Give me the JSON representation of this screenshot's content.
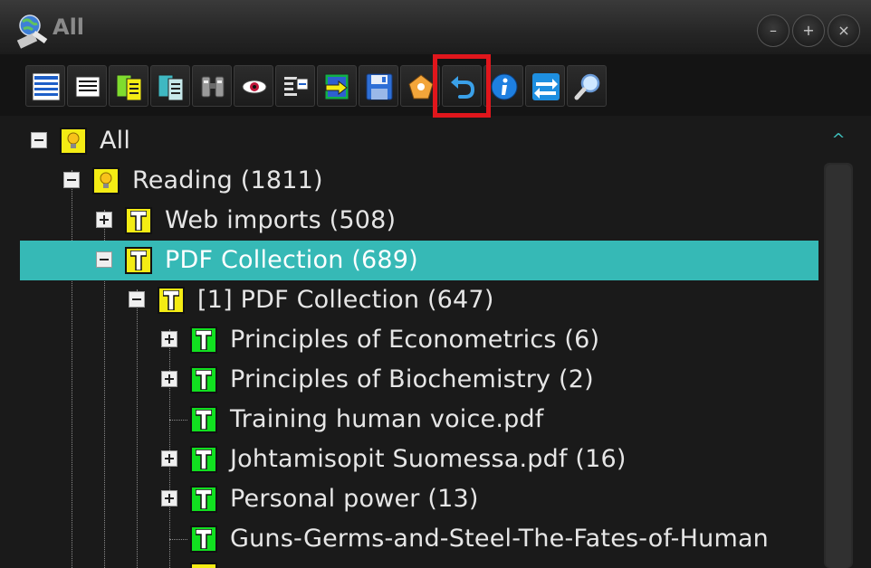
{
  "window": {
    "title": "All"
  },
  "window_controls": {
    "minimize": "–",
    "maximize": "+",
    "close": "×"
  },
  "toolbar": {
    "buttons": [
      "list-all-icon",
      "list-icon",
      "copy-green-icon",
      "copy-teal-icon",
      "binoculars-icon",
      "eye-icon",
      "outline-icon",
      "import-export-icon",
      "save-icon",
      "pentagon-icon",
      "undo-icon",
      "info-icon",
      "swap-icon",
      "search-icon"
    ],
    "highlighted": "undo-icon"
  },
  "tree": {
    "items": [
      {
        "label": "All",
        "level": 0,
        "state": "expanded",
        "icon": "bulb-icon"
      },
      {
        "label": "Reading (1811)",
        "level": 1,
        "state": "expanded",
        "icon": "bulb-icon"
      },
      {
        "label": "Web imports (508)",
        "level": 2,
        "state": "collapsed",
        "icon": "topic-yellow-icon"
      },
      {
        "label": "PDF Collection (689)",
        "level": 2,
        "state": "expanded",
        "icon": "topic-yellow-icon",
        "selected": true
      },
      {
        "label": "[1] PDF Collection (647)",
        "level": 3,
        "state": "expanded",
        "icon": "topic-yellow-icon"
      },
      {
        "label": "Principles of Econometrics (6)",
        "level": 4,
        "state": "collapsed",
        "icon": "topic-green-icon"
      },
      {
        "label": "Principles of Biochemistry (2)",
        "level": 4,
        "state": "collapsed",
        "icon": "topic-green-icon"
      },
      {
        "label": "Training human voice.pdf",
        "level": 4,
        "state": "leaf",
        "icon": "topic-green-icon"
      },
      {
        "label": "Johtamisopit Suomessa.pdf (16)",
        "level": 4,
        "state": "collapsed",
        "icon": "topic-green-icon"
      },
      {
        "label": "Personal power (13)",
        "level": 4,
        "state": "collapsed",
        "icon": "topic-green-icon"
      },
      {
        "label": "Guns-Germs-and-Steel-The-Fates-of-Human",
        "level": 4,
        "state": "leaf",
        "icon": "topic-green-icon"
      }
    ]
  },
  "colors": {
    "selection": "#36b9b6",
    "highlight_border": "#e0161c",
    "topic_yellow": "#f4ec14",
    "topic_green": "#11e020"
  },
  "scrollbar": {
    "up_arrow": "^"
  }
}
